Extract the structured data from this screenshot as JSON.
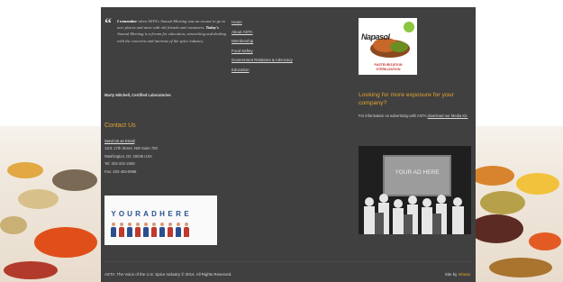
{
  "colors": {
    "panel": "#404040",
    "accent": "#e2a331",
    "text": "#dcdcdc"
  },
  "testimonial": {
    "lead": "I remember",
    "part1": " when ASTA's Annual Meeting was an excuse to go to nice places and meet with old friends and customers. ",
    "today": "Today's",
    "part2": " Annual Meeting is a forum for education, networking and dealing with the concerns and interests of the spice industry.",
    "author": "Marty Mitchell, Certified Laboratories"
  },
  "contact": {
    "title": "Contact Us",
    "email_link": "Send Us an Email",
    "address1": "1101 17th Street, NW Suite 700",
    "address2": "Washington, DC 20036 USA",
    "tel": "Tel: 202-331-2460",
    "fax": "Fax: 202-463-8998"
  },
  "ad_banner": {
    "text": "YOURADHERE",
    "icon": "people-banner-icon"
  },
  "nav": [
    "Home",
    "About ASTA",
    "Membership",
    "Food Safety",
    "Government Relations & Advocacy",
    "Education"
  ],
  "sponsor": {
    "name": "Napasol",
    "tagline1": "PASTEURIZATION",
    "tagline2": "STERILIZATION"
  },
  "exposure": {
    "title": "Looking for more exposure for your company?",
    "text": "For information on advertising with ASTA ",
    "link": "download our Media Kit."
  },
  "photo_ad": {
    "text": "YOUR AD HERE"
  },
  "footer": {
    "copyright": "ASTA: The Voice of the U.S. Spice Industry © 2014. All Rights Reserved.",
    "site_by": "Site by ",
    "brand": "Infanta"
  }
}
